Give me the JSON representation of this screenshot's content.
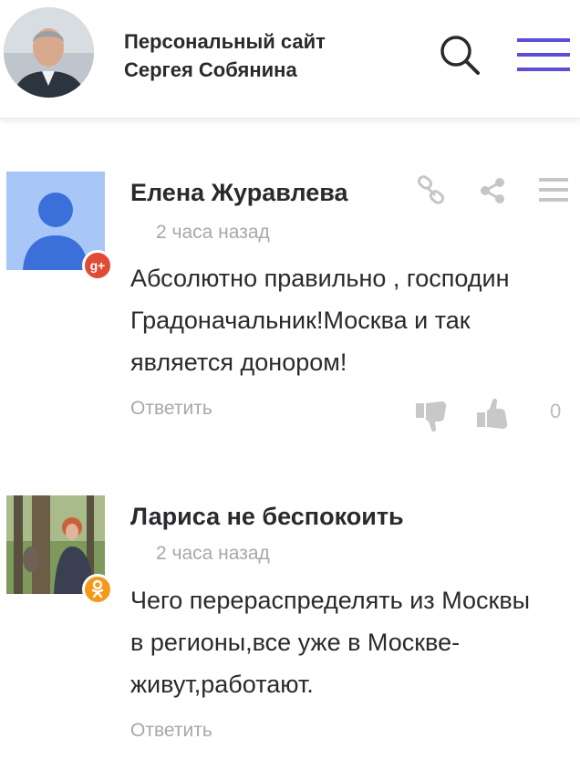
{
  "header": {
    "title_line1": "Персональный сайт",
    "title_line2": "Сергея Собянина",
    "accent_color": "#5b4fd6"
  },
  "comments": [
    {
      "author": "Елена Журавлева",
      "time": "2 часа назад",
      "text_lines": [
        "Абсолютно правильно , господин",
        "Градоначальник!Москва и так",
        "является донором!"
      ],
      "reply_label": "Ответить",
      "votes": "0",
      "network": "google-plus",
      "network_badge": "g+",
      "network_color": "#e04b36"
    },
    {
      "author": "Лариса не беспокоить",
      "time": "2 часа назад",
      "text_lines": [
        "Чего перераспределять из Москвы",
        "в регионы,все уже в Москве-",
        "живут,работают."
      ],
      "reply_label": "Ответить",
      "network": "odnoklassniki",
      "network_color": "#f39a1c"
    }
  ]
}
